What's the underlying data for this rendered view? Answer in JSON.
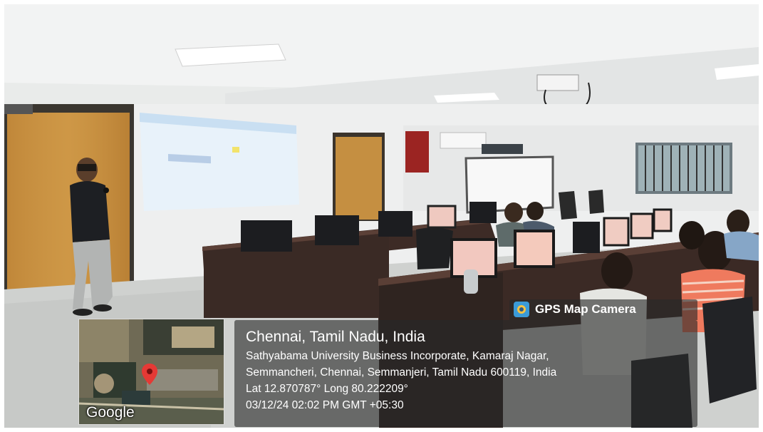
{
  "photo": {
    "description_free": true
  },
  "gps_badge": {
    "app_name": "GPS Map Camera",
    "icon": "map-pin-camera-icon"
  },
  "location": {
    "title": "Chennai, Tamil Nadu, India",
    "address_line1": "Sathyabama University Business Incorporate, Kamaraj Nagar,",
    "address_line2": "Semmancheri, Chennai, Semmanjeri, Tamil Nadu 600119, India",
    "coordinates": "Lat 12.870787° Long 80.222209°",
    "timestamp": "03/12/24 02:02 PM GMT +05:30"
  },
  "map": {
    "provider": "Google",
    "marker_icon": "map-marker-icon"
  },
  "colors": {
    "marker": "#e53935",
    "badge_icon": "#3b9bd8"
  }
}
